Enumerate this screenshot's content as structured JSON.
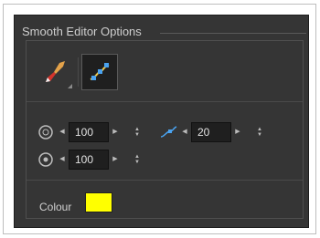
{
  "panel": {
    "title": "Smooth Editor Options"
  },
  "tools": [
    {
      "name": "brush",
      "icon": "brush-icon",
      "selected": false
    },
    {
      "name": "smooth-editor",
      "icon": "smooth-editor-icon",
      "selected": true
    }
  ],
  "fields": {
    "size": {
      "value": "100",
      "icon": "circle-size-icon"
    },
    "smoothness": {
      "value": "20",
      "icon": "smooth-curve-icon"
    },
    "pressure": {
      "value": "100",
      "icon": "circle-pressure-icon"
    }
  },
  "colour": {
    "label": "Colour",
    "value": "#ffff00"
  }
}
